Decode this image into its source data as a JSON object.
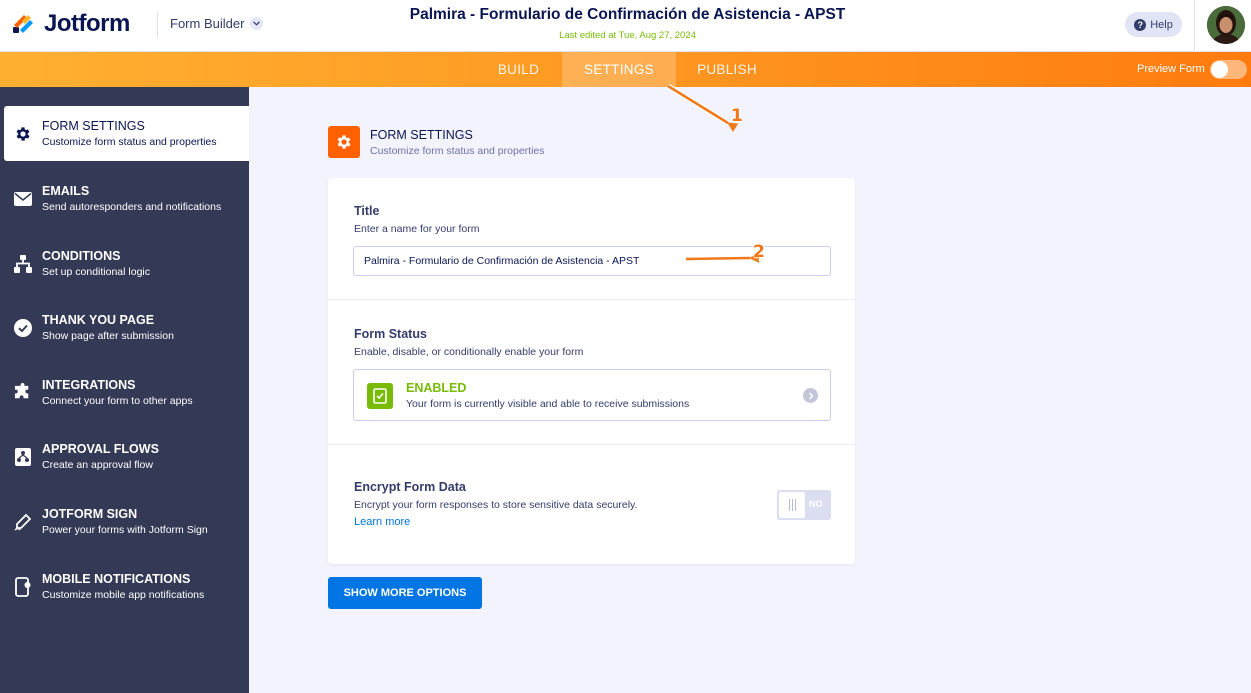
{
  "header": {
    "brand": "Jotform",
    "mode_label": "Form Builder",
    "form_title": "Palmira - Formulario de Confirmación de Asistencia - APST",
    "last_edited": "Last edited at Tue, Aug 27, 2024",
    "help_label": "Help"
  },
  "nav": {
    "tabs": [
      {
        "label": "BUILD",
        "active": false
      },
      {
        "label": "SETTINGS",
        "active": true
      },
      {
        "label": "PUBLISH",
        "active": false
      }
    ],
    "preview_label": "Preview Form"
  },
  "sidebar": {
    "items": [
      {
        "title": "FORM SETTINGS",
        "sub": "Customize form status and properties",
        "icon": "gear-icon"
      },
      {
        "title": "EMAILS",
        "sub": "Send autoresponders and notifications",
        "icon": "envelope-icon"
      },
      {
        "title": "CONDITIONS",
        "sub": "Set up conditional logic",
        "icon": "hierarchy-icon"
      },
      {
        "title": "THANK YOU PAGE",
        "sub": "Show page after submission",
        "icon": "check-circle-icon"
      },
      {
        "title": "INTEGRATIONS",
        "sub": "Connect your form to other apps",
        "icon": "puzzle-icon"
      },
      {
        "title": "APPROVAL FLOWS",
        "sub": "Create an approval flow",
        "icon": "flow-icon"
      },
      {
        "title": "JOTFORM SIGN",
        "sub": "Power your forms with Jotform Sign",
        "icon": "pen-icon"
      },
      {
        "title": "MOBILE NOTIFICATIONS",
        "sub": "Customize mobile app notifications",
        "icon": "mobile-bell-icon"
      }
    ]
  },
  "main": {
    "section_title": "FORM SETTINGS",
    "section_sub": "Customize form status and properties",
    "title_label": "Title",
    "title_desc": "Enter a name for your form",
    "title_value": "Palmira - Formulario de Confirmación de Asistencia - APST",
    "status_label": "Form Status",
    "status_desc": "Enable, disable, or conditionally enable your form",
    "status_value": "ENABLED",
    "status_detail": "Your form is currently visible and able to receive submissions",
    "encrypt_label": "Encrypt Form Data",
    "encrypt_desc": "Encrypt your form responses to store sensitive data securely.",
    "learn_more": "Learn more",
    "encrypt_toggle": "NO",
    "more_button": "SHOW MORE OPTIONS"
  },
  "annotations": {
    "one": "1",
    "two": "2"
  },
  "colors": {
    "brand_orange": "#ff6100",
    "sidebar_bg": "#343a55",
    "enabled_green": "#78bb07",
    "primary_blue": "#0075e3"
  }
}
